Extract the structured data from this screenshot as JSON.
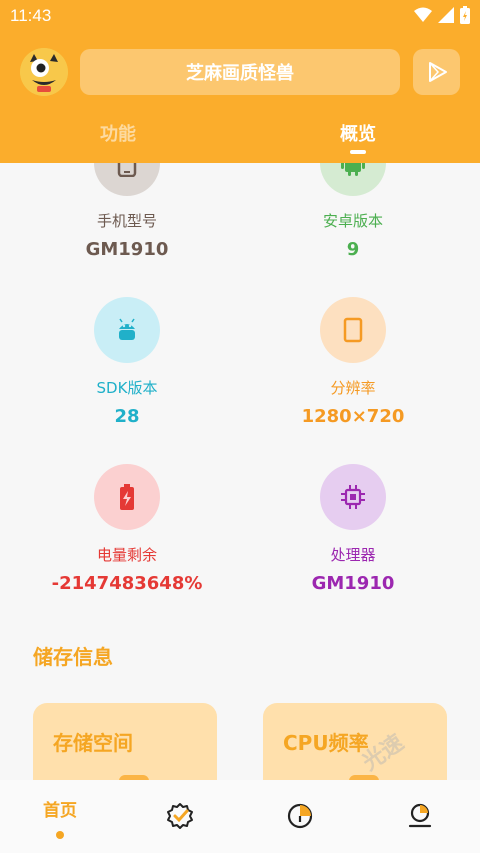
{
  "status_bar": {
    "time": "11:43"
  },
  "header": {
    "app_title": "芝麻画质怪兽",
    "tabs": [
      {
        "label": "功能"
      },
      {
        "label": "概览"
      }
    ]
  },
  "device_info": [
    {
      "label": "手机型号",
      "value": "GM1910",
      "icon": "phone-icon",
      "circle_color": "#dcd6d2",
      "label_color": "#6d5a50",
      "value_color": "#6d5a50"
    },
    {
      "label": "安卓版本",
      "value": "9",
      "icon": "android-icon",
      "circle_color": "#d5ebd2",
      "label_color": "#4caf50",
      "value_color": "#4caf50"
    },
    {
      "label": "SDK版本",
      "value": "28",
      "icon": "android-head-icon",
      "circle_color": "#c9eef6",
      "label_color": "#20b0c9",
      "value_color": "#20b0c9"
    },
    {
      "label": "分辨率",
      "value": "1280×720",
      "icon": "screen-icon",
      "circle_color": "#fde0c0",
      "label_color": "#f59a23",
      "value_color": "#f59a23"
    },
    {
      "label": "电量剩余",
      "value": "-2147483648%",
      "icon": "battery-icon",
      "circle_color": "#fbd0d0",
      "label_color": "#e53935",
      "value_color": "#e53935"
    },
    {
      "label": "处理器",
      "value": "GM1910",
      "icon": "chip-icon",
      "circle_color": "#e6cdf0",
      "label_color": "#9c27b0",
      "value_color": "#9c27b0"
    }
  ],
  "storage_section": {
    "title": "储存信息",
    "cards": [
      {
        "title": "存储空间"
      },
      {
        "title": "CPU频率"
      }
    ]
  },
  "bottom_nav": {
    "home_label": "首页"
  },
  "watermark": "光速"
}
